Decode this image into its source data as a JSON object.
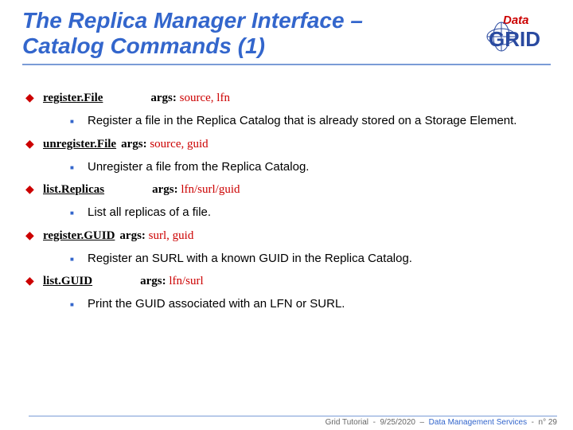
{
  "title_line1": "The Replica Manager Interface –",
  "title_line2": "Catalog Commands (1)",
  "logo": {
    "top": "Data",
    "bottom": "GRID"
  },
  "commands": [
    {
      "name": "register.File",
      "args_label": "args:",
      "args": "source, lfn",
      "args_inline": false,
      "desc": "Register a file in the Replica Catalog that is already stored on a Storage Element."
    },
    {
      "name": "unregister.File",
      "args_label": "args:",
      "args": "source, guid",
      "args_inline": true,
      "desc": "Unregister a file from the Replica Catalog."
    },
    {
      "name": "list.Replicas",
      "args_label": "args:",
      "args": "lfn/surl/guid",
      "args_inline": false,
      "desc": "List all replicas of a file."
    },
    {
      "name": "register.GUID",
      "args_label": "args:",
      "args": "surl, guid",
      "args_inline": true,
      "desc": "Register an SURL with a known GUID in the Replica Catalog."
    },
    {
      "name": "list.GUID",
      "args_label": "args:",
      "args": "lfn/surl",
      "args_inline": false,
      "desc": "Print the GUID associated with an LFN or SURL."
    }
  ],
  "footer": {
    "left": "Grid Tutorial",
    "date": "9/25/2020",
    "service": "Data Management Services",
    "page": "n° 29"
  }
}
